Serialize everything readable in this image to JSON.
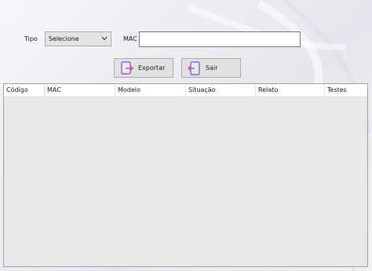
{
  "form": {
    "tipo_label": "Tipo",
    "tipo_value": "Selecione",
    "mac_label": "MAC",
    "mac_value": ""
  },
  "toolbar": {
    "export_label": "Exportar",
    "exit_label": "Sair"
  },
  "grid": {
    "columns": [
      "Código",
      "MAC",
      "Modelo",
      "Situação",
      "Relato",
      "Testes"
    ],
    "rows": []
  }
}
